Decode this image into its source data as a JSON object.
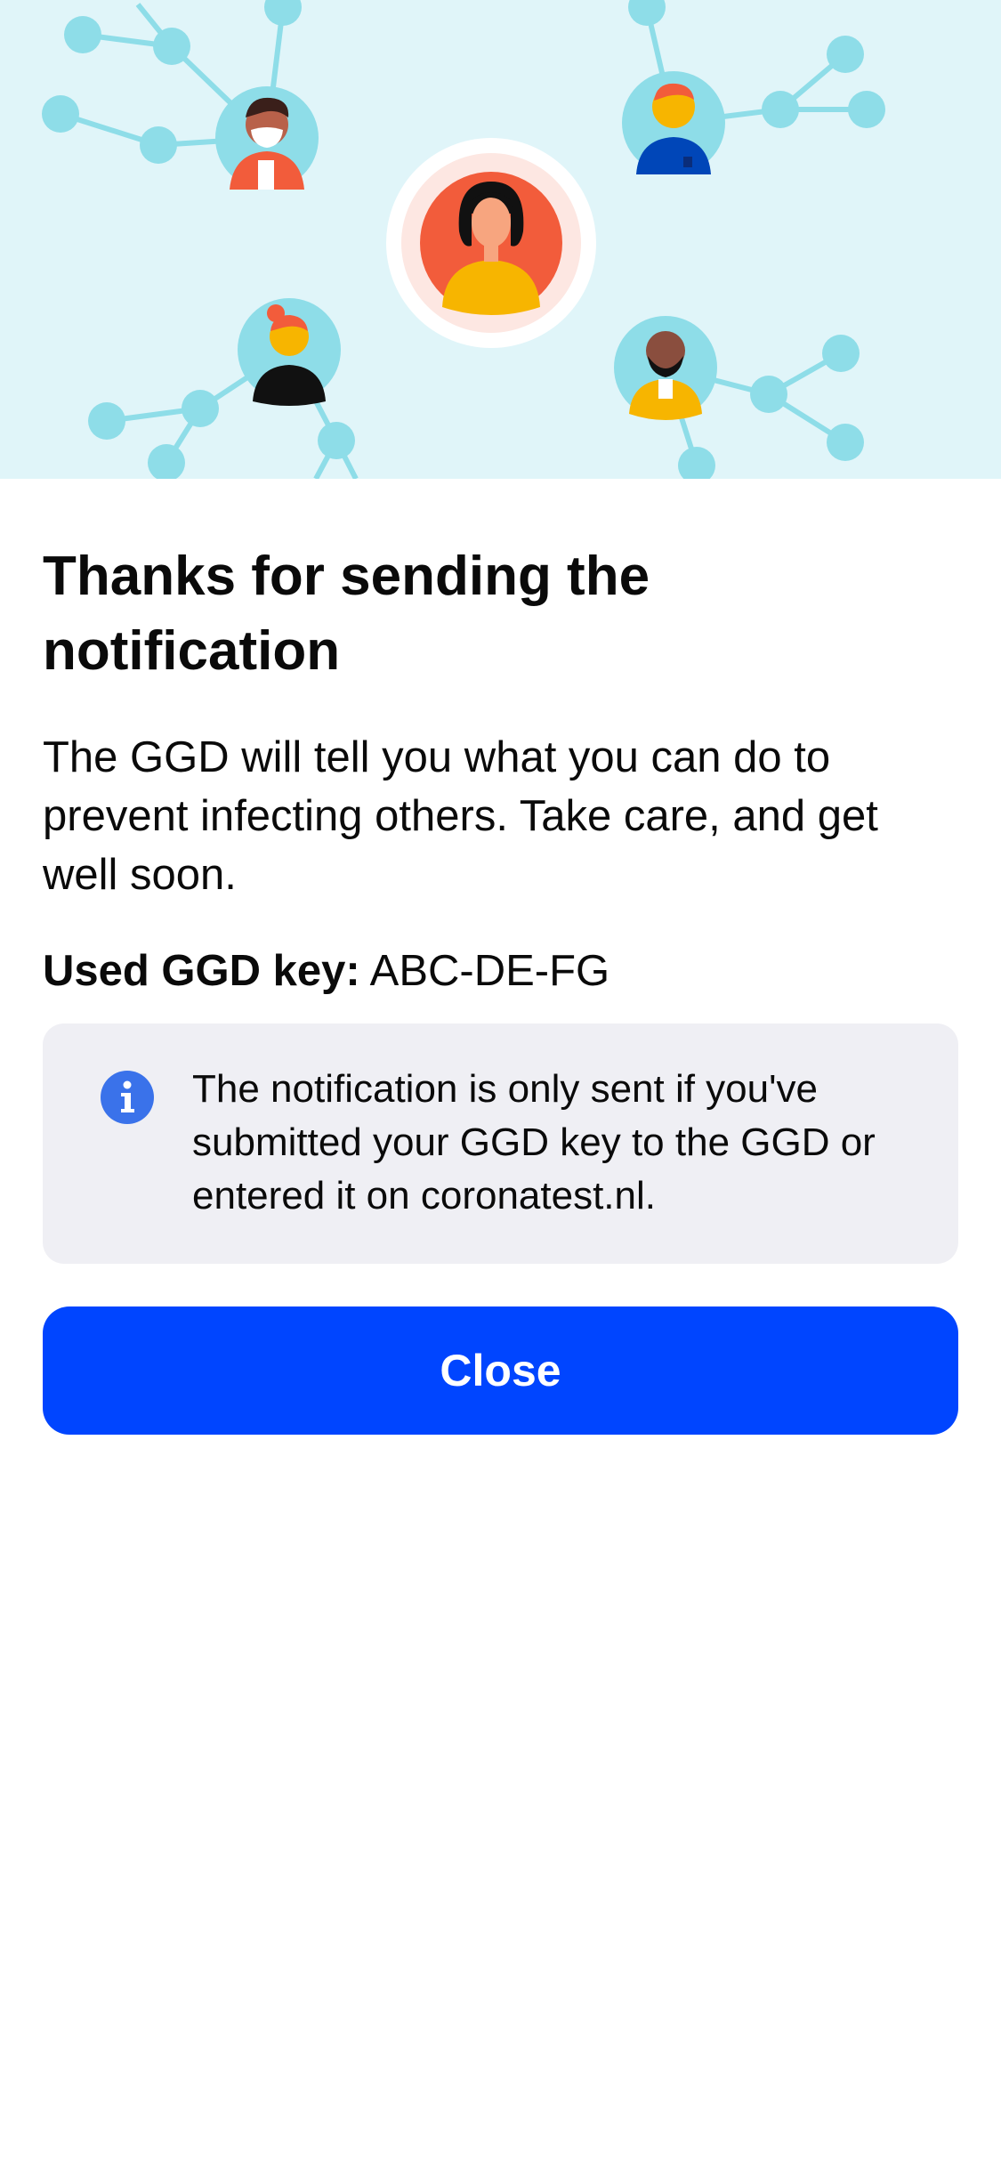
{
  "hero": {
    "illustration": "people-network-illustration",
    "colors": {
      "background": "#e0f5f9",
      "node": "#8edde8",
      "accent": "#f25c3b"
    }
  },
  "title": "Thanks for sending the notification",
  "body": "The GGD will tell you what you can do to prevent infecting others. Take care, and get well soon.",
  "key": {
    "label": "Used GGD key:",
    "value": "ABC-DE-FG"
  },
  "info": {
    "icon": "info-icon",
    "text": "The notification is only sent if you've submitted your GGD key to the GGD or entered it on coronatest.nl."
  },
  "actions": {
    "close_label": "Close"
  },
  "colors": {
    "primary": "#0045ff",
    "card": "#efeff4",
    "info_icon": "#3a72ea"
  }
}
